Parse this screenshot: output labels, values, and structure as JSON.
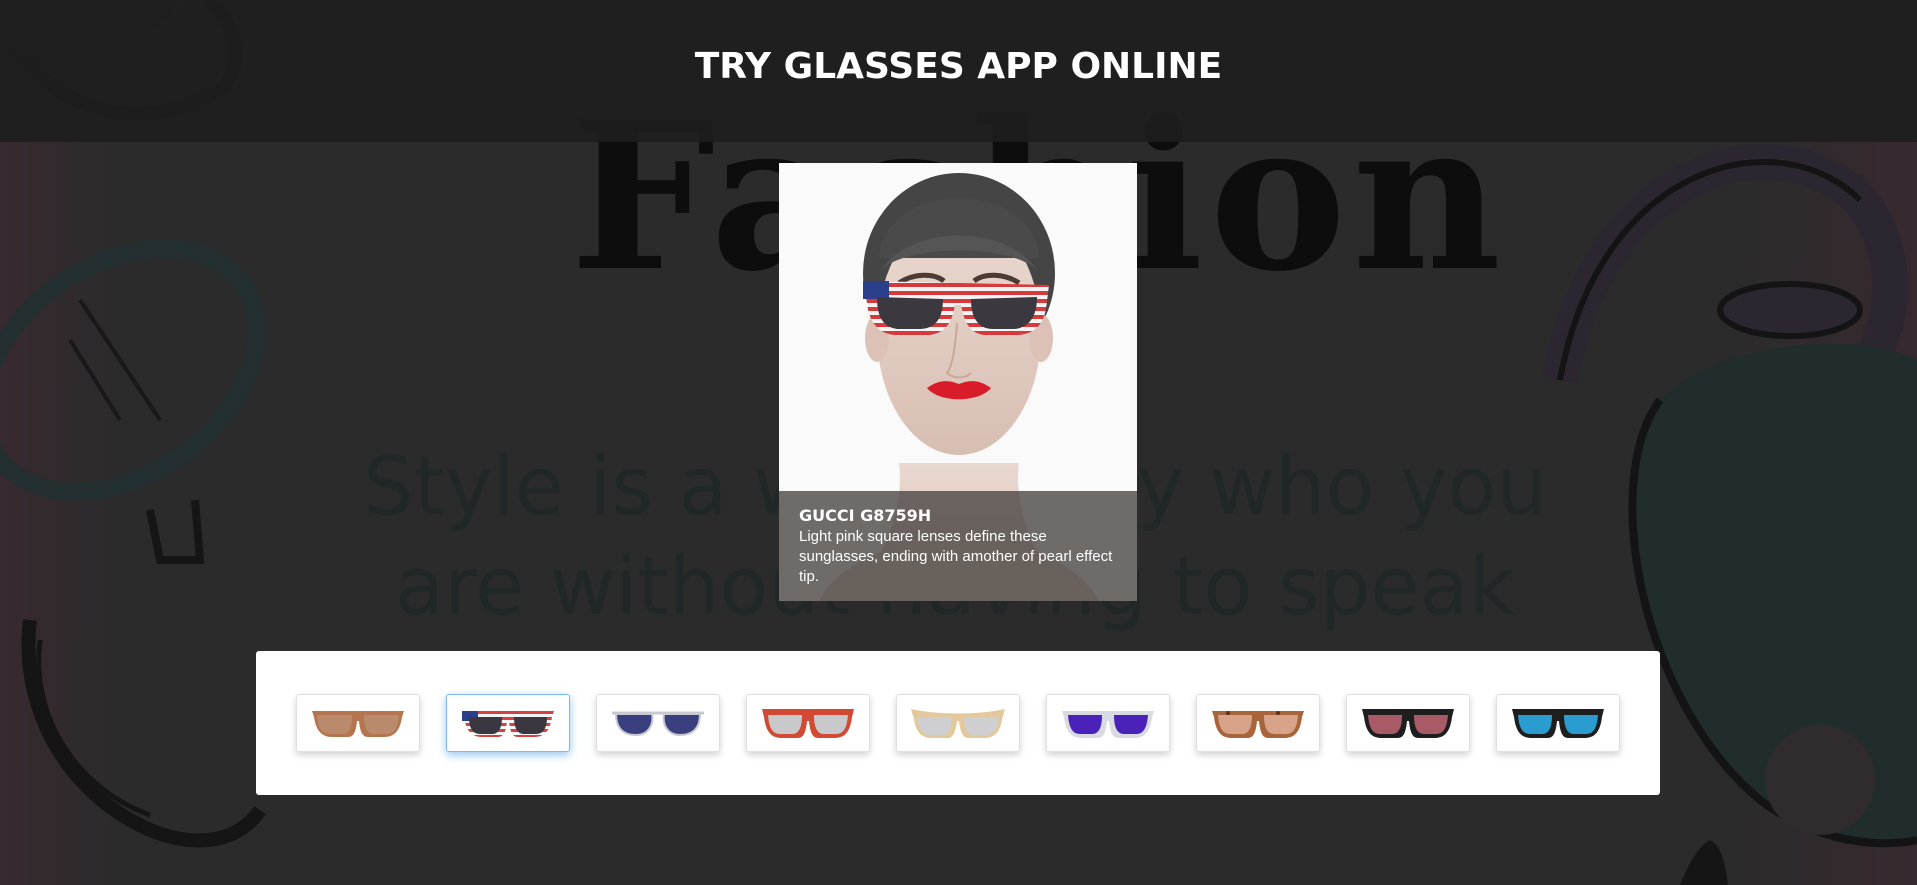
{
  "header": {
    "title": "TRY GLASSES APP ONLINE"
  },
  "background": {
    "headline": "Fashion",
    "quote": "Style is a way to say who you are without having to speak"
  },
  "preview": {
    "product_name": "GUCCI G8759H",
    "product_description": "Light pink square lenses define these sunglasses, ending with amother of pearl effect tip.",
    "worn_frame": "american-flag"
  },
  "carousel": {
    "selected_index": 1,
    "items": [
      {
        "icon": "brown-wayfarer-sunglasses-icon",
        "frame": "#b5754f",
        "lens": "#b98a6c"
      },
      {
        "icon": "american-flag-sunglasses-icon",
        "frame": "#d64040",
        "lens": "#3a3740"
      },
      {
        "icon": "navy-aviator-sunglasses-icon",
        "frame": "#c8c8d0",
        "lens": "#3a3f80"
      },
      {
        "icon": "red-wayfarer-sunglasses-icon",
        "frame": "#d24a34",
        "lens": "#c9c9cc"
      },
      {
        "icon": "gold-cat-eye-sunglasses-icon",
        "frame": "#e2c89a",
        "lens": "#cfcfd1"
      },
      {
        "icon": "purple-clear-frame-sunglasses-icon",
        "frame": "#d9dbe3",
        "lens": "#4a22b8"
      },
      {
        "icon": "tortoise-shell-sunglasses-icon",
        "frame": "#a8643a",
        "lens": "#d7a48a"
      },
      {
        "icon": "black-red-mirror-sunglasses-icon",
        "frame": "#1e1e1e",
        "lens": "#a85a66"
      },
      {
        "icon": "black-blue-mirror-sunglasses-icon",
        "frame": "#1e1e1e",
        "lens": "#2a9ccf"
      }
    ]
  }
}
